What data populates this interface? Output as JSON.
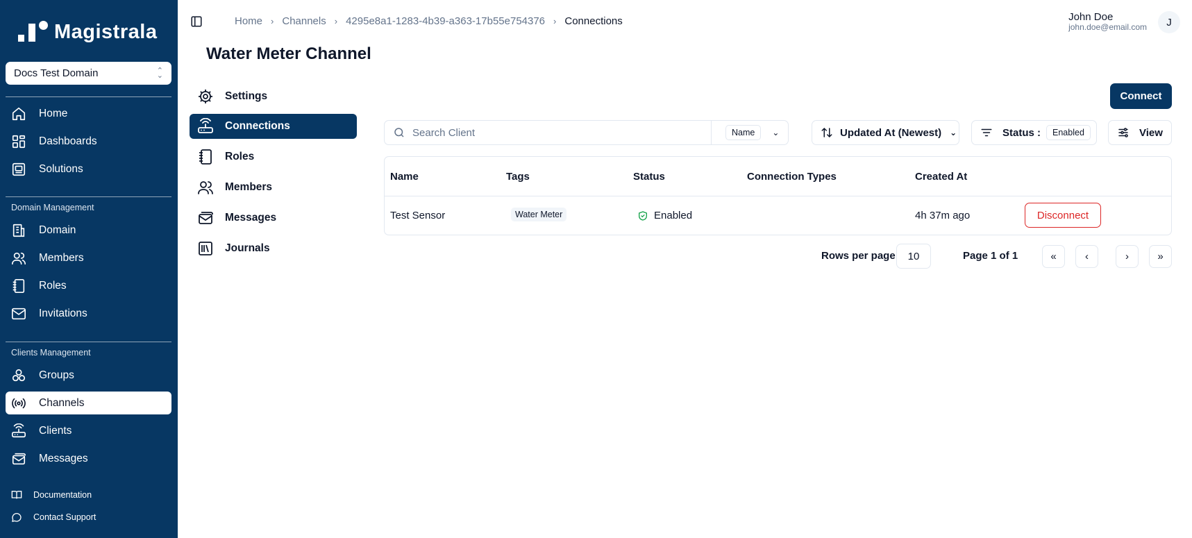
{
  "app": {
    "logo_text": "Magistrala",
    "brand_color": "#073763"
  },
  "sidebar": {
    "domain": "Docs Test Domain",
    "main_items": [
      {
        "label": "Home",
        "icon": "home-icon"
      },
      {
        "label": "Dashboards",
        "icon": "dashboard-icon"
      },
      {
        "label": "Solutions",
        "icon": "solutions-icon"
      }
    ],
    "domain_section_label": "Domain Management",
    "domain_items": [
      {
        "label": "Domain",
        "icon": "building-icon"
      },
      {
        "label": "Members",
        "icon": "users-icon"
      },
      {
        "label": "Roles",
        "icon": "notebook-icon"
      },
      {
        "label": "Invitations",
        "icon": "mail-icon"
      }
    ],
    "clients_section_label": "Clients Management",
    "clients_items": [
      {
        "label": "Groups",
        "icon": "groups-icon"
      },
      {
        "label": "Channels",
        "icon": "broadcast-icon",
        "active": true
      },
      {
        "label": "Clients",
        "icon": "router-icon"
      },
      {
        "label": "Messages",
        "icon": "mail-stack-icon"
      }
    ],
    "footer_items": [
      {
        "label": "Documentation",
        "icon": "book-icon"
      },
      {
        "label": "Contact Support",
        "icon": "chat-icon"
      }
    ]
  },
  "breadcrumb": [
    "Home",
    "Channels",
    "4295e8a1-1283-4b39-a363-17b55e754376",
    "Connections"
  ],
  "user": {
    "name": "John Doe",
    "email": "john.doe@email.com",
    "initial": "J"
  },
  "page_title": "Water Meter Channel",
  "subnav": [
    {
      "label": "Settings",
      "icon": "gear-icon"
    },
    {
      "label": "Connections",
      "icon": "router-icon",
      "active": true
    },
    {
      "label": "Roles",
      "icon": "notebook-icon"
    },
    {
      "label": "Members",
      "icon": "users-icon"
    },
    {
      "label": "Messages",
      "icon": "mail-stack-icon"
    },
    {
      "label": "Journals",
      "icon": "library-icon"
    }
  ],
  "toolbar": {
    "connect_label": "Connect",
    "search_placeholder": "Search Client",
    "search_field": "Name",
    "sort_label": "Updated At (Newest)",
    "status_label": "Status :",
    "status_value": "Enabled",
    "view_label": "View"
  },
  "table": {
    "headers": [
      "Name",
      "Tags",
      "Status",
      "Connection Types",
      "Created At"
    ],
    "rows": [
      {
        "name": "Test Sensor",
        "tag": "Water Meter",
        "status": "Enabled",
        "connection_types": "",
        "created_at": "4h 37m ago",
        "action": "Disconnect"
      }
    ]
  },
  "pagination": {
    "rows_label": "Rows per page",
    "rows_value": "10",
    "page_info": "Page 1 of 1"
  }
}
